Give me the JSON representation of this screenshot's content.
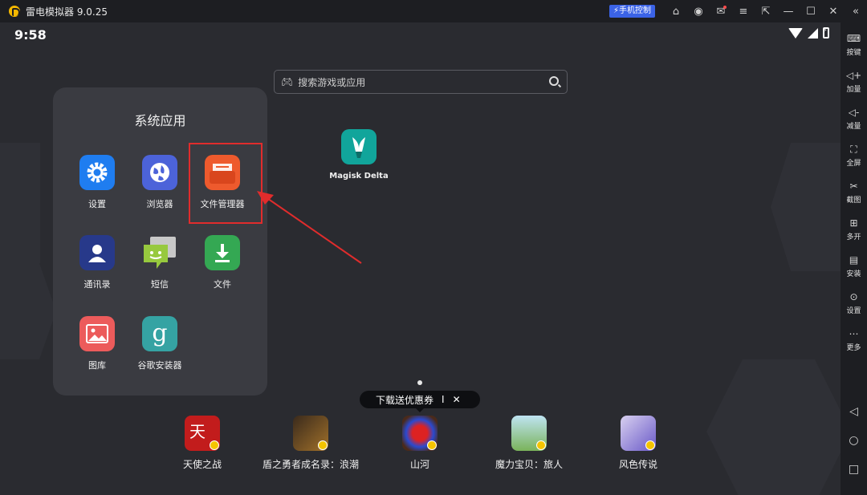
{
  "titlebar": {
    "app_name": "雷电模拟器 9.0.25",
    "phone_control": "手机控制",
    "icons": [
      "gamepad-icon",
      "user-icon",
      "mail-icon",
      "menu-icon",
      "exit-icon",
      "minimize-icon",
      "maximize-icon",
      "close-icon",
      "collapse-icon"
    ]
  },
  "status_bar": {
    "time": "9:58"
  },
  "search": {
    "placeholder": "搜索游戏或应用"
  },
  "folder": {
    "title": "系统应用",
    "apps": [
      {
        "label": "设置",
        "icon": "gear-icon",
        "color": "#1f7df0"
      },
      {
        "label": "浏览器",
        "icon": "globe-icon",
        "color": "#4c63d9"
      },
      {
        "label": "文件管理器",
        "icon": "folder-icon",
        "color": "#ee5a2d"
      },
      {
        "label": "通讯录",
        "icon": "contact-icon",
        "color": "#27398a"
      },
      {
        "label": "短信",
        "icon": "message-icon",
        "color": "#97c93e"
      },
      {
        "label": "文件",
        "icon": "download-icon",
        "color": "#34a853"
      },
      {
        "label": "图库",
        "icon": "gallery-icon",
        "color": "#ec5b5b"
      },
      {
        "label": "谷歌安装器",
        "icon": "g-icon",
        "color": "#35a3a3"
      }
    ]
  },
  "desktop_app": {
    "label": "Magisk Delta",
    "icon": "magisk-icon"
  },
  "promo": {
    "text": "下载送优惠券",
    "sep": "I",
    "close": "✕"
  },
  "games": [
    {
      "label": "天使之战",
      "color": "#c21c1c"
    },
    {
      "label": "盾之勇者成名录：浪潮",
      "color": "#6b4a2c"
    },
    {
      "label": "山河",
      "color": "#8a2020"
    },
    {
      "label": "魔力宝贝：旅人",
      "color": "#7fc3e0"
    },
    {
      "label": "风色传说",
      "color": "#8a8ad8"
    }
  ],
  "sidebar": {
    "items": [
      {
        "label": "按键",
        "icon": "keyboard-icon",
        "glyph": "⌨"
      },
      {
        "label": "加量",
        "icon": "volume-up-icon",
        "glyph": "◁+"
      },
      {
        "label": "减量",
        "icon": "volume-down-icon",
        "glyph": "◁-"
      },
      {
        "label": "全屏",
        "icon": "fullscreen-icon",
        "glyph": "⛶"
      },
      {
        "label": "截图",
        "icon": "scissors-icon",
        "glyph": "✂"
      },
      {
        "label": "多开",
        "icon": "multi-open-icon",
        "glyph": "⊞"
      },
      {
        "label": "安装",
        "icon": "apk-icon",
        "glyph": "▤"
      },
      {
        "label": "设置",
        "icon": "settings-icon",
        "glyph": "⊙"
      },
      {
        "label": "更多",
        "icon": "more-icon",
        "glyph": "⋯"
      }
    ],
    "nav": [
      {
        "icon": "back-icon",
        "glyph": "◁"
      },
      {
        "icon": "home-icon",
        "glyph": "○"
      },
      {
        "icon": "recents-icon",
        "glyph": "□"
      }
    ]
  },
  "annotation": {
    "highlight_color": "#e02c2c"
  }
}
